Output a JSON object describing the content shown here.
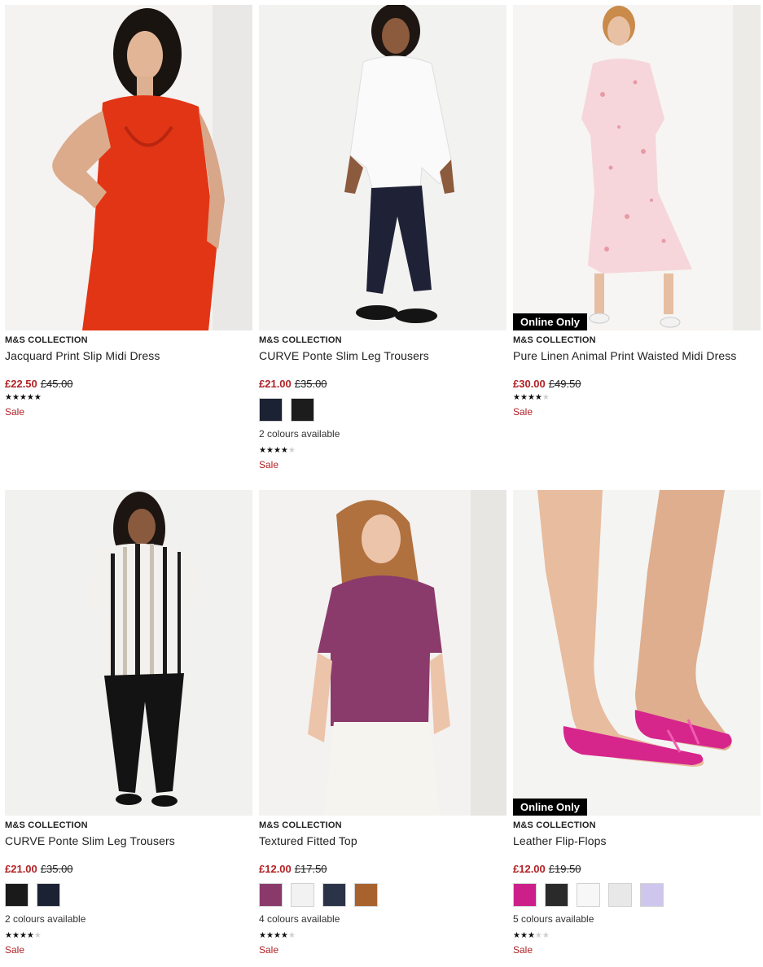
{
  "products": [
    {
      "brand": "M&S COLLECTION",
      "name": "Jacquard Print Slip Midi Dress",
      "price_now": "£22.50",
      "price_was": "£45.00",
      "rating": 5,
      "sale": "Sale",
      "badge": "",
      "colours_text": "",
      "swatches": [],
      "image_icon": "red-slip-dress-model"
    },
    {
      "brand": "M&S COLLECTION",
      "name": "CURVE Ponte Slim Leg Trousers",
      "price_now": "£21.00",
      "price_was": "£35.00",
      "rating": 4,
      "sale": "Sale",
      "badge": "",
      "colours_text": "2 colours available",
      "swatches": [
        "#1b2233",
        "#1c1c1c"
      ],
      "image_icon": "white-shirt-navy-trousers-model"
    },
    {
      "brand": "M&S COLLECTION",
      "name": "Pure Linen Animal Print Waisted Midi Dress",
      "price_now": "£30.00",
      "price_was": "£49.50",
      "rating": 4,
      "sale": "Sale",
      "badge": "Online Only",
      "colours_text": "",
      "swatches": [],
      "image_icon": "pink-linen-dress-model"
    },
    {
      "brand": "M&S COLLECTION",
      "name": "CURVE Ponte Slim Leg Trousers",
      "price_now": "£21.00",
      "price_was": "£35.00",
      "rating": 4,
      "sale": "Sale",
      "badge": "",
      "colours_text": "2 colours available",
      "swatches": [
        "#1a1a1a",
        "#1a2233"
      ],
      "image_icon": "striped-top-black-trousers-model"
    },
    {
      "brand": "M&S COLLECTION",
      "name": "Textured Fitted Top",
      "price_now": "£12.00",
      "price_was": "£17.50",
      "rating": 4,
      "sale": "Sale",
      "badge": "",
      "colours_text": "4 colours available",
      "swatches": [
        "#8a3a6a",
        "#f2f2f2",
        "#2a3348",
        "#a8622e"
      ],
      "image_icon": "purple-fitted-top-model"
    },
    {
      "brand": "M&S COLLECTION",
      "name": "Leather Flip-Flops",
      "price_now": "£12.00",
      "price_was": "£19.50",
      "rating": 3,
      "sale": "Sale",
      "badge": "Online Only",
      "colours_text": "5 colours available",
      "swatches": [
        "#cc1f8a",
        "#2a2a2a",
        "#f7f7f7",
        "#e8e8e8",
        "#cfc6ee"
      ],
      "image_icon": "pink-flip-flops-feet"
    }
  ],
  "colors": {
    "sale_red": "#b12226",
    "badge_bg": "#000000",
    "star_on": "#111111",
    "star_off": "#cfcfcf"
  }
}
